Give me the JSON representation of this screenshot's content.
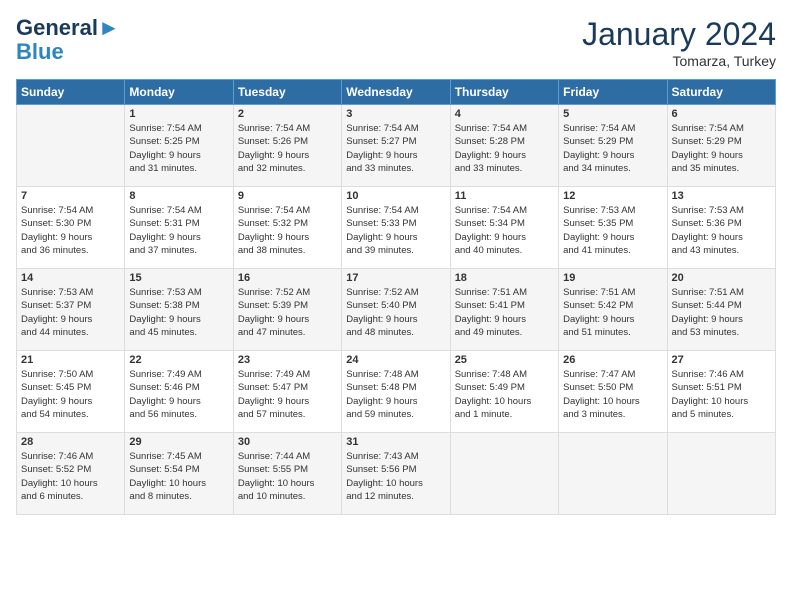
{
  "header": {
    "logo_line1": "General",
    "logo_line2": "Blue",
    "month": "January 2024",
    "location": "Tomarza, Turkey"
  },
  "days_of_week": [
    "Sunday",
    "Monday",
    "Tuesday",
    "Wednesday",
    "Thursday",
    "Friday",
    "Saturday"
  ],
  "weeks": [
    [
      {
        "day": "",
        "content": ""
      },
      {
        "day": "1",
        "content": "Sunrise: 7:54 AM\nSunset: 5:25 PM\nDaylight: 9 hours\nand 31 minutes."
      },
      {
        "day": "2",
        "content": "Sunrise: 7:54 AM\nSunset: 5:26 PM\nDaylight: 9 hours\nand 32 minutes."
      },
      {
        "day": "3",
        "content": "Sunrise: 7:54 AM\nSunset: 5:27 PM\nDaylight: 9 hours\nand 33 minutes."
      },
      {
        "day": "4",
        "content": "Sunrise: 7:54 AM\nSunset: 5:28 PM\nDaylight: 9 hours\nand 33 minutes."
      },
      {
        "day": "5",
        "content": "Sunrise: 7:54 AM\nSunset: 5:29 PM\nDaylight: 9 hours\nand 34 minutes."
      },
      {
        "day": "6",
        "content": "Sunrise: 7:54 AM\nSunset: 5:29 PM\nDaylight: 9 hours\nand 35 minutes."
      }
    ],
    [
      {
        "day": "7",
        "content": "Sunrise: 7:54 AM\nSunset: 5:30 PM\nDaylight: 9 hours\nand 36 minutes."
      },
      {
        "day": "8",
        "content": "Sunrise: 7:54 AM\nSunset: 5:31 PM\nDaylight: 9 hours\nand 37 minutes."
      },
      {
        "day": "9",
        "content": "Sunrise: 7:54 AM\nSunset: 5:32 PM\nDaylight: 9 hours\nand 38 minutes."
      },
      {
        "day": "10",
        "content": "Sunrise: 7:54 AM\nSunset: 5:33 PM\nDaylight: 9 hours\nand 39 minutes."
      },
      {
        "day": "11",
        "content": "Sunrise: 7:54 AM\nSunset: 5:34 PM\nDaylight: 9 hours\nand 40 minutes."
      },
      {
        "day": "12",
        "content": "Sunrise: 7:53 AM\nSunset: 5:35 PM\nDaylight: 9 hours\nand 41 minutes."
      },
      {
        "day": "13",
        "content": "Sunrise: 7:53 AM\nSunset: 5:36 PM\nDaylight: 9 hours\nand 43 minutes."
      }
    ],
    [
      {
        "day": "14",
        "content": "Sunrise: 7:53 AM\nSunset: 5:37 PM\nDaylight: 9 hours\nand 44 minutes."
      },
      {
        "day": "15",
        "content": "Sunrise: 7:53 AM\nSunset: 5:38 PM\nDaylight: 9 hours\nand 45 minutes."
      },
      {
        "day": "16",
        "content": "Sunrise: 7:52 AM\nSunset: 5:39 PM\nDaylight: 9 hours\nand 47 minutes."
      },
      {
        "day": "17",
        "content": "Sunrise: 7:52 AM\nSunset: 5:40 PM\nDaylight: 9 hours\nand 48 minutes."
      },
      {
        "day": "18",
        "content": "Sunrise: 7:51 AM\nSunset: 5:41 PM\nDaylight: 9 hours\nand 49 minutes."
      },
      {
        "day": "19",
        "content": "Sunrise: 7:51 AM\nSunset: 5:42 PM\nDaylight: 9 hours\nand 51 minutes."
      },
      {
        "day": "20",
        "content": "Sunrise: 7:51 AM\nSunset: 5:44 PM\nDaylight: 9 hours\nand 53 minutes."
      }
    ],
    [
      {
        "day": "21",
        "content": "Sunrise: 7:50 AM\nSunset: 5:45 PM\nDaylight: 9 hours\nand 54 minutes."
      },
      {
        "day": "22",
        "content": "Sunrise: 7:49 AM\nSunset: 5:46 PM\nDaylight: 9 hours\nand 56 minutes."
      },
      {
        "day": "23",
        "content": "Sunrise: 7:49 AM\nSunset: 5:47 PM\nDaylight: 9 hours\nand 57 minutes."
      },
      {
        "day": "24",
        "content": "Sunrise: 7:48 AM\nSunset: 5:48 PM\nDaylight: 9 hours\nand 59 minutes."
      },
      {
        "day": "25",
        "content": "Sunrise: 7:48 AM\nSunset: 5:49 PM\nDaylight: 10 hours\nand 1 minute."
      },
      {
        "day": "26",
        "content": "Sunrise: 7:47 AM\nSunset: 5:50 PM\nDaylight: 10 hours\nand 3 minutes."
      },
      {
        "day": "27",
        "content": "Sunrise: 7:46 AM\nSunset: 5:51 PM\nDaylight: 10 hours\nand 5 minutes."
      }
    ],
    [
      {
        "day": "28",
        "content": "Sunrise: 7:46 AM\nSunset: 5:52 PM\nDaylight: 10 hours\nand 6 minutes."
      },
      {
        "day": "29",
        "content": "Sunrise: 7:45 AM\nSunset: 5:54 PM\nDaylight: 10 hours\nand 8 minutes."
      },
      {
        "day": "30",
        "content": "Sunrise: 7:44 AM\nSunset: 5:55 PM\nDaylight: 10 hours\nand 10 minutes."
      },
      {
        "day": "31",
        "content": "Sunrise: 7:43 AM\nSunset: 5:56 PM\nDaylight: 10 hours\nand 12 minutes."
      },
      {
        "day": "",
        "content": ""
      },
      {
        "day": "",
        "content": ""
      },
      {
        "day": "",
        "content": ""
      }
    ]
  ]
}
